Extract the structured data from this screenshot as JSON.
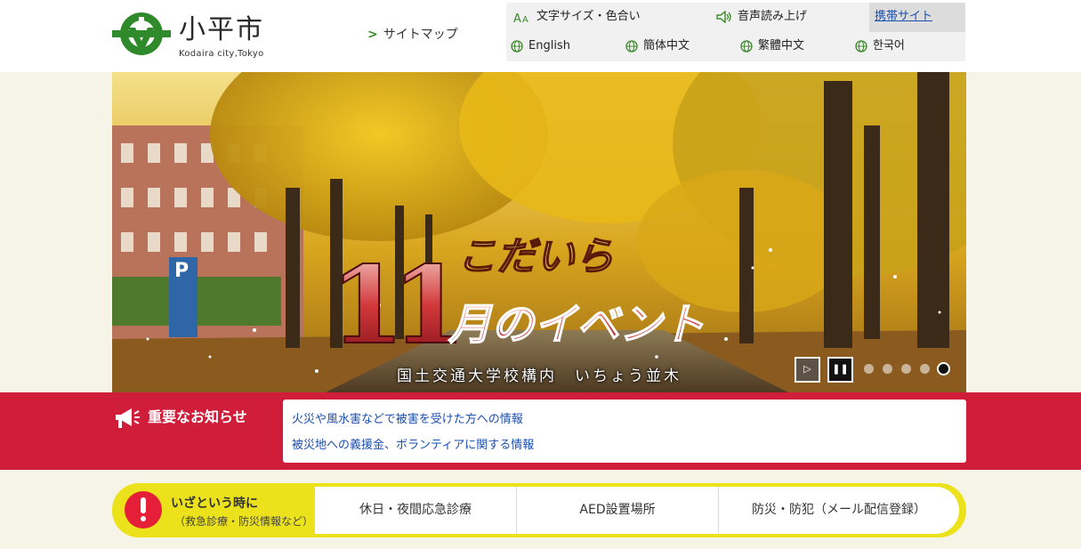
{
  "header": {
    "logo_title": "小平市",
    "logo_sub": "Kodaira city,Tokyo",
    "sitemap_label": "サイトマップ",
    "utility": {
      "text_size_color": "文字サイズ・色合い",
      "voice_read": "音声読み上げ",
      "mobile_site": "携帯サイト",
      "languages": [
        "English",
        "簡体中文",
        "繁體中文",
        "한국어"
      ]
    }
  },
  "hero": {
    "banner_number": "11",
    "banner_line1": "こだいら",
    "banner_line2": "月のイベント",
    "caption": "国土交通大学校構内　いちょう並木",
    "parking_sign": "P",
    "slide_count": 5,
    "active_slide": 5
  },
  "notice": {
    "title": "重要なお知らせ",
    "links": [
      "火災や風水害などで被害を受けた方への情報",
      "被災地への義援金、ボランティアに関する情報"
    ]
  },
  "emergency": {
    "title": "いざという時に",
    "subtitle": "（救急診療・防災情報など）",
    "links": [
      "休日・夜間応急診療",
      "AED設置場所",
      "防災・防犯（メール配信登録）"
    ]
  },
  "colors": {
    "brand_green": "#2f8a2c",
    "notice_red": "#cf1d3a",
    "emergency_yellow": "#ece21c",
    "link_blue": "#1b4fb0",
    "page_bg": "#f6f3e7"
  },
  "icons": {
    "logo": "city-emblem-icon",
    "text_size": "text-size-icon",
    "voice": "speaker-icon",
    "language": "globe-icon",
    "notice": "megaphone-icon",
    "emergency": "exclamation-icon",
    "play": "play-icon",
    "pause": "pause-icon"
  }
}
